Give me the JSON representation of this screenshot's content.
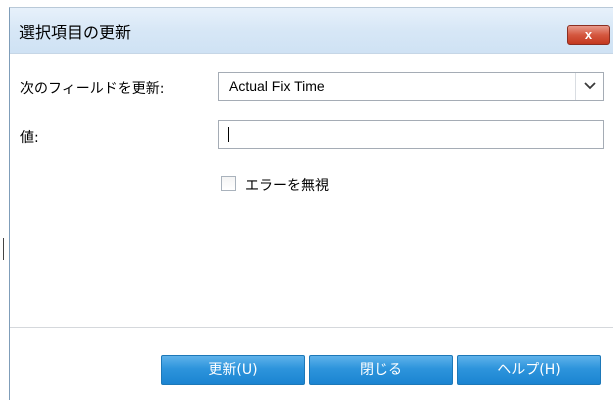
{
  "dialog": {
    "title": "選択項目の更新",
    "close_label": "x"
  },
  "form": {
    "field_label": "次のフィールドを更新:",
    "field_value": "Actual Fix Time",
    "value_label": "値:",
    "value_input": "",
    "ignore_errors_label": "エラーを無視",
    "ignore_errors_checked": false
  },
  "buttons": {
    "update": "更新(U)",
    "close": "閉じる",
    "help": "ヘルプ(H)"
  },
  "colors": {
    "button_blue": "#2d94dc",
    "close_red": "#c3381f",
    "titlebar": "#d7e7f6"
  },
  "icons": {
    "dropdown": "chevron-down-icon",
    "close": "close-icon"
  }
}
